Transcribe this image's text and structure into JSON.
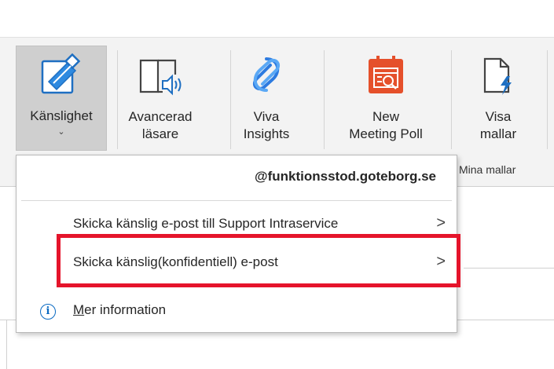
{
  "ribbon": {
    "buttons": [
      {
        "label": "Känslighet",
        "icon": "sensitivity-icon",
        "has_dropdown": true
      },
      {
        "label": "Avancerad\nläsare",
        "icon": "immersive-reader-icon"
      },
      {
        "label": "Viva\nInsights",
        "icon": "viva-insights-icon"
      },
      {
        "label": "New\nMeeting Poll",
        "icon": "meeting-poll-icon"
      },
      {
        "label": "Visa\nmallar",
        "icon": "templates-icon"
      }
    ],
    "group_label": "Mina mallar",
    "chevron": "⌄"
  },
  "dropdown": {
    "header": "@funktionsstod.goteborg.se",
    "items": [
      {
        "label": "Skicka känslig e-post till Support Intraservice",
        "arrow": ">"
      },
      {
        "label": "Skicka känslig(konfidentiell) e-post",
        "arrow": ">",
        "highlighted": true
      }
    ],
    "info": {
      "icon": "info-icon",
      "underlined_letter": "M",
      "rest": "er information"
    }
  },
  "colors": {
    "highlight": "#e5142b",
    "accent_blue": "#0a6ac2",
    "poll_orange": "#e5502b"
  }
}
